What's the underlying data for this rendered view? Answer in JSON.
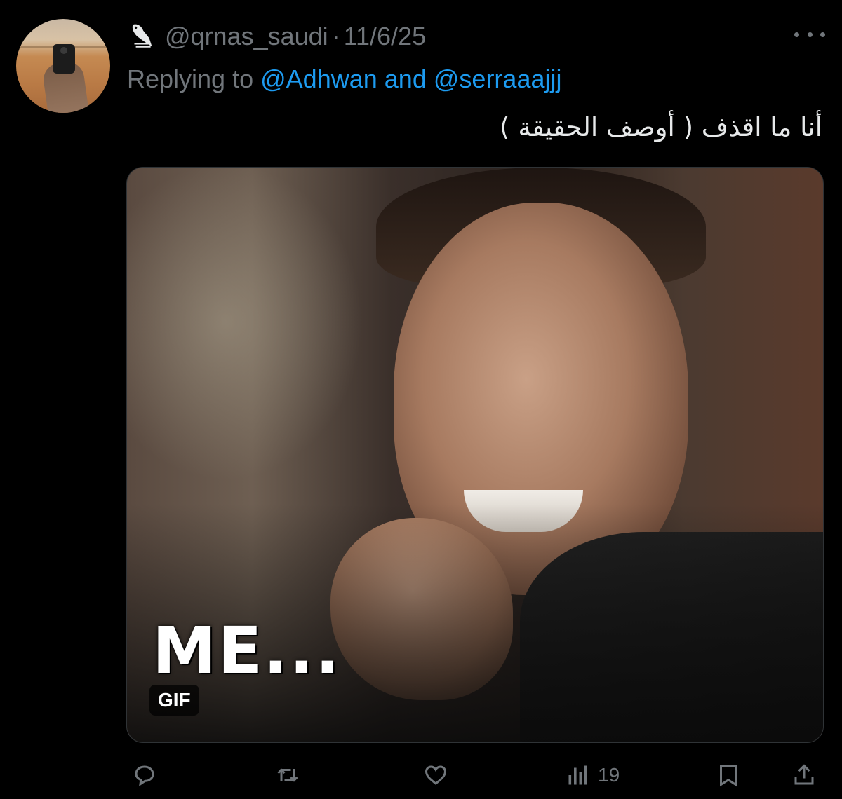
{
  "tweet": {
    "author_handle": "@qrnas_saudi",
    "separator": "·",
    "date": "11/6/25",
    "replying_prefix": "Replying to",
    "mention_1": "@Adhwan",
    "conjunction": "and",
    "mention_2": "@serraaajjj",
    "text": "أنا ما اقذف ( أوصف الحقيقة )"
  },
  "media": {
    "caption": "ME...",
    "badge": "GIF"
  },
  "actions": {
    "views_count": "19"
  },
  "colors": {
    "background": "#000000",
    "primary_text": "#e7e9ea",
    "secondary_text": "#71767b",
    "link": "#1d9bf0"
  },
  "icons": [
    "avatar",
    "falcon-icon",
    "more-icon",
    "reply-icon",
    "retweet-icon",
    "like-icon",
    "views-icon",
    "bookmark-icon",
    "share-icon"
  ]
}
